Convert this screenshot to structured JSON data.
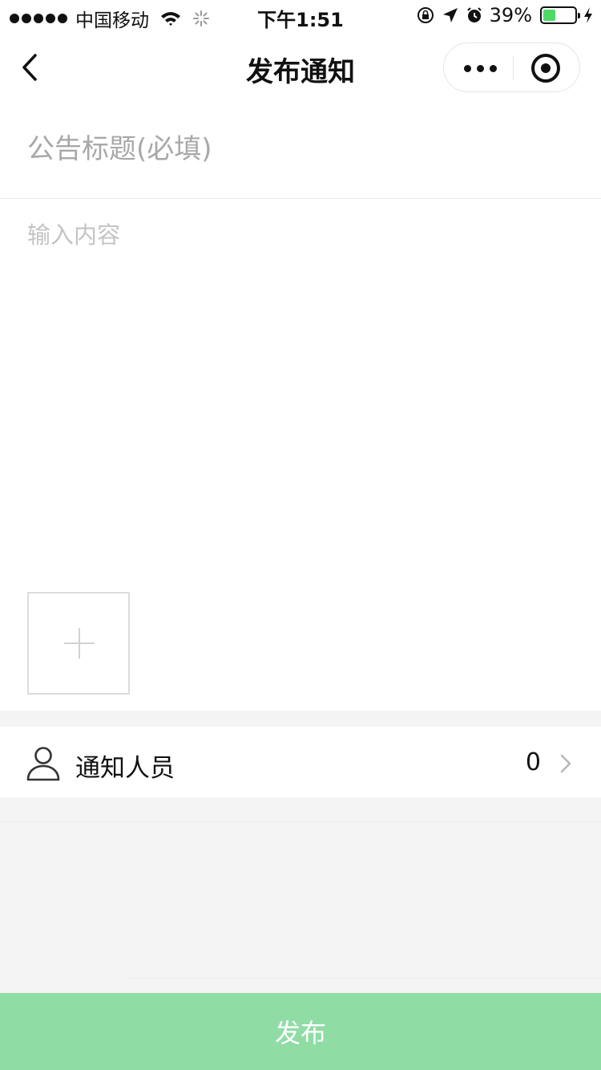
{
  "status_bar": {
    "carrier": "中国移动",
    "time": "下午1:51",
    "battery_text": "39%",
    "battery_level": 0.39,
    "battery_color": "#4cd964"
  },
  "nav": {
    "title": "发布通知",
    "back_icon": "chevron-left-icon",
    "more_icon": "more-dots-icon",
    "close_icon": "target-circle-icon"
  },
  "form": {
    "title_value": "",
    "title_placeholder": "公告标题(必填)",
    "content_value": "",
    "content_placeholder": "输入内容",
    "add_image_icon": "plus-icon"
  },
  "recipients": {
    "icon": "person-icon",
    "label": "通知人员",
    "count": "0"
  },
  "publish": {
    "label": "发布",
    "color": "#8fdda5"
  }
}
